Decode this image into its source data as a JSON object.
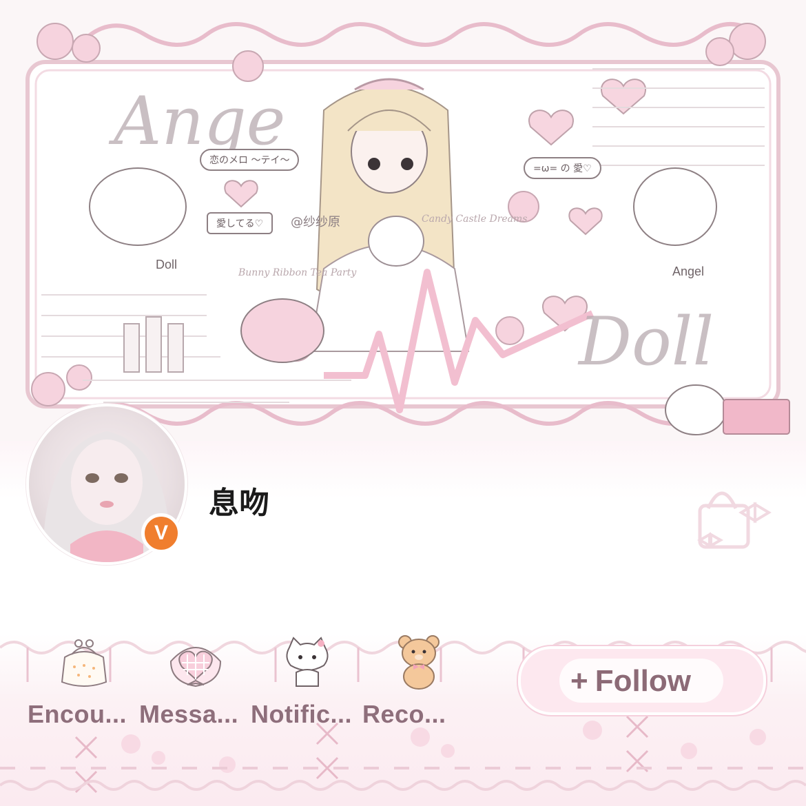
{
  "banner": {
    "watermark_handle": "@纱纱原",
    "watermark_candy": "Candy Castle Dreams",
    "watermark_bunny": "Bunny Ribbon Tea Party",
    "word_angel": "Ange",
    "word_doll": "Doll",
    "label_doll": "Doll",
    "label_angel": "Angel",
    "bubble_1": "恋のメロ ～テイ～",
    "bubble_2": "=ω= の 愛♡",
    "bubble_3": "愛してる♡"
  },
  "profile": {
    "username": "息吻",
    "verified_badge": "V"
  },
  "nav": {
    "items": [
      {
        "label": "Encou...",
        "icon": "coin-purse-icon"
      },
      {
        "label": "Messa...",
        "icon": "plaid-heart-icon"
      },
      {
        "label": "Notific...",
        "icon": "kitty-icon"
      },
      {
        "label": "Reco...",
        "icon": "teddy-bear-icon"
      }
    ]
  },
  "follow": {
    "plus": "+",
    "label": "Follow"
  },
  "colors": {
    "accent_pink": "#f5cfdc",
    "label_mauve": "#8e6e7b",
    "badge_orange": "#f07e2e"
  }
}
